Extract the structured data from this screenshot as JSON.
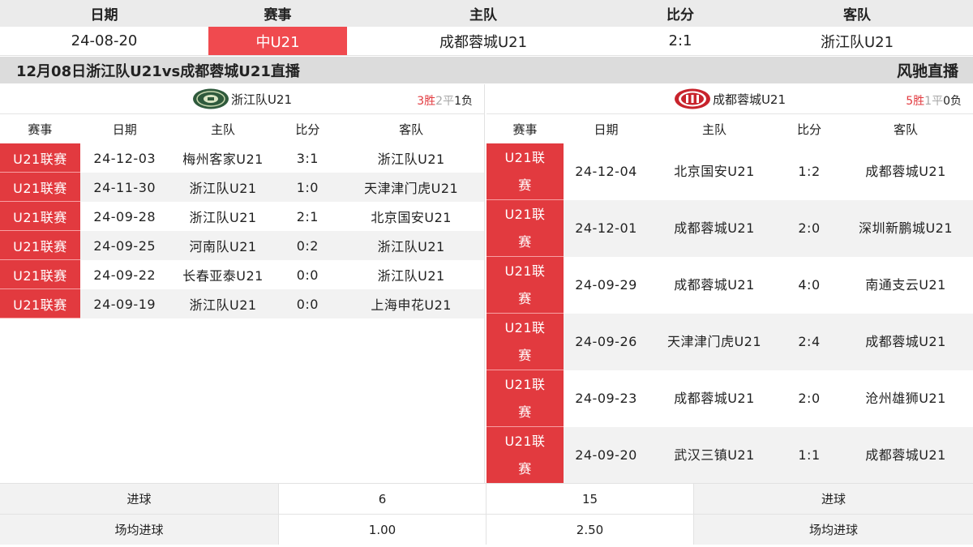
{
  "top": {
    "headers": [
      "日期",
      "赛事",
      "主队",
      "比分",
      "客队"
    ],
    "date": "24-08-20",
    "league": "中U21",
    "home": "成都蓉城U21",
    "score": "2:1",
    "away": "浙江队U21"
  },
  "title_bar": {
    "title": "12月08日浙江队U21vs成都蓉城U21直播",
    "brand": "风驰直播"
  },
  "left_panel": {
    "team_name": "浙江队U21",
    "record": {
      "wins": "3胜",
      "draws": "2平",
      "losses": "1负"
    },
    "columns": [
      "赛事",
      "日期",
      "主队",
      "比分",
      "客队"
    ],
    "rows": [
      {
        "league": "U21联赛",
        "date": "24-12-03",
        "home": "梅州客家U21",
        "score": "3:1",
        "away": "浙江队U21"
      },
      {
        "league": "U21联赛",
        "date": "24-11-30",
        "home": "浙江队U21",
        "score": "1:0",
        "away": "天津津门虎U21"
      },
      {
        "league": "U21联赛",
        "date": "24-09-28",
        "home": "浙江队U21",
        "score": "2:1",
        "away": "北京国安U21"
      },
      {
        "league": "U21联赛",
        "date": "24-09-25",
        "home": "河南队U21",
        "score": "0:2",
        "away": "浙江队U21"
      },
      {
        "league": "U21联赛",
        "date": "24-09-22",
        "home": "长春亚泰U21",
        "score": "0:0",
        "away": "浙江队U21"
      },
      {
        "league": "U21联赛",
        "date": "24-09-19",
        "home": "浙江队U21",
        "score": "0:0",
        "away": "上海申花U21"
      }
    ]
  },
  "right_panel": {
    "team_name": "成都蓉城U21",
    "record": {
      "wins": "5胜",
      "draws": "1平",
      "losses": "0负"
    },
    "columns": [
      "赛事",
      "日期",
      "主队",
      "比分",
      "客队"
    ],
    "rows": [
      {
        "league": "U21联赛",
        "date": "24-12-04",
        "home": "北京国安U21",
        "score": "1:2",
        "away": "成都蓉城U21"
      },
      {
        "league": "U21联赛",
        "date": "24-12-01",
        "home": "成都蓉城U21",
        "score": "2:0",
        "away": "深圳新鹏城U21"
      },
      {
        "league": "U21联赛",
        "date": "24-09-29",
        "home": "成都蓉城U21",
        "score": "4:0",
        "away": "南通支云U21"
      },
      {
        "league": "U21联赛",
        "date": "24-09-26",
        "home": "天津津门虎U21",
        "score": "2:4",
        "away": "成都蓉城U21"
      },
      {
        "league": "U21联赛",
        "date": "24-09-23",
        "home": "成都蓉城U21",
        "score": "2:0",
        "away": "沧州雄狮U21"
      },
      {
        "league": "U21联赛",
        "date": "24-09-20",
        "home": "武汉三镇U21",
        "score": "1:1",
        "away": "成都蓉城U21"
      }
    ]
  },
  "stats": [
    {
      "label": "进球",
      "left": "6",
      "right": "15"
    },
    {
      "label": "场均进球",
      "left": "1.00",
      "right": "2.50"
    }
  ],
  "colors": {
    "accent_red": "#e23a3f",
    "header_gray": "#ebebeb",
    "title_gray": "#dcdcdc"
  },
  "icons": {
    "left_logo": "zhejiang-club-crest-icon",
    "right_logo": "chengdu-rongcheng-crest-icon"
  }
}
